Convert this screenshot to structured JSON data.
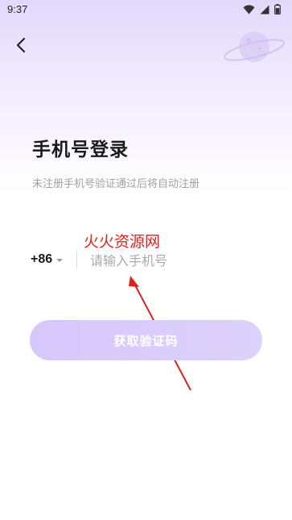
{
  "status_bar": {
    "time": "9:37",
    "icons": [
      "wifi-icon",
      "signal-icon",
      "battery-icon"
    ]
  },
  "nav": {
    "back_icon": "chevron-left-icon"
  },
  "login": {
    "title": "手机号登录",
    "subtitle": "未注册手机号验证通过后将自动注册",
    "country_code": "+86",
    "phone_placeholder": "请输入手机号",
    "phone_value": "",
    "get_code_label": "获取验证码"
  },
  "overlay": {
    "watermark_text": "火火资源网"
  },
  "colors": {
    "accent_light": "#d6c7fb",
    "annotation_red": "#e0201e",
    "title": "#1a1a1a",
    "subtitle": "#a0a0a8"
  }
}
